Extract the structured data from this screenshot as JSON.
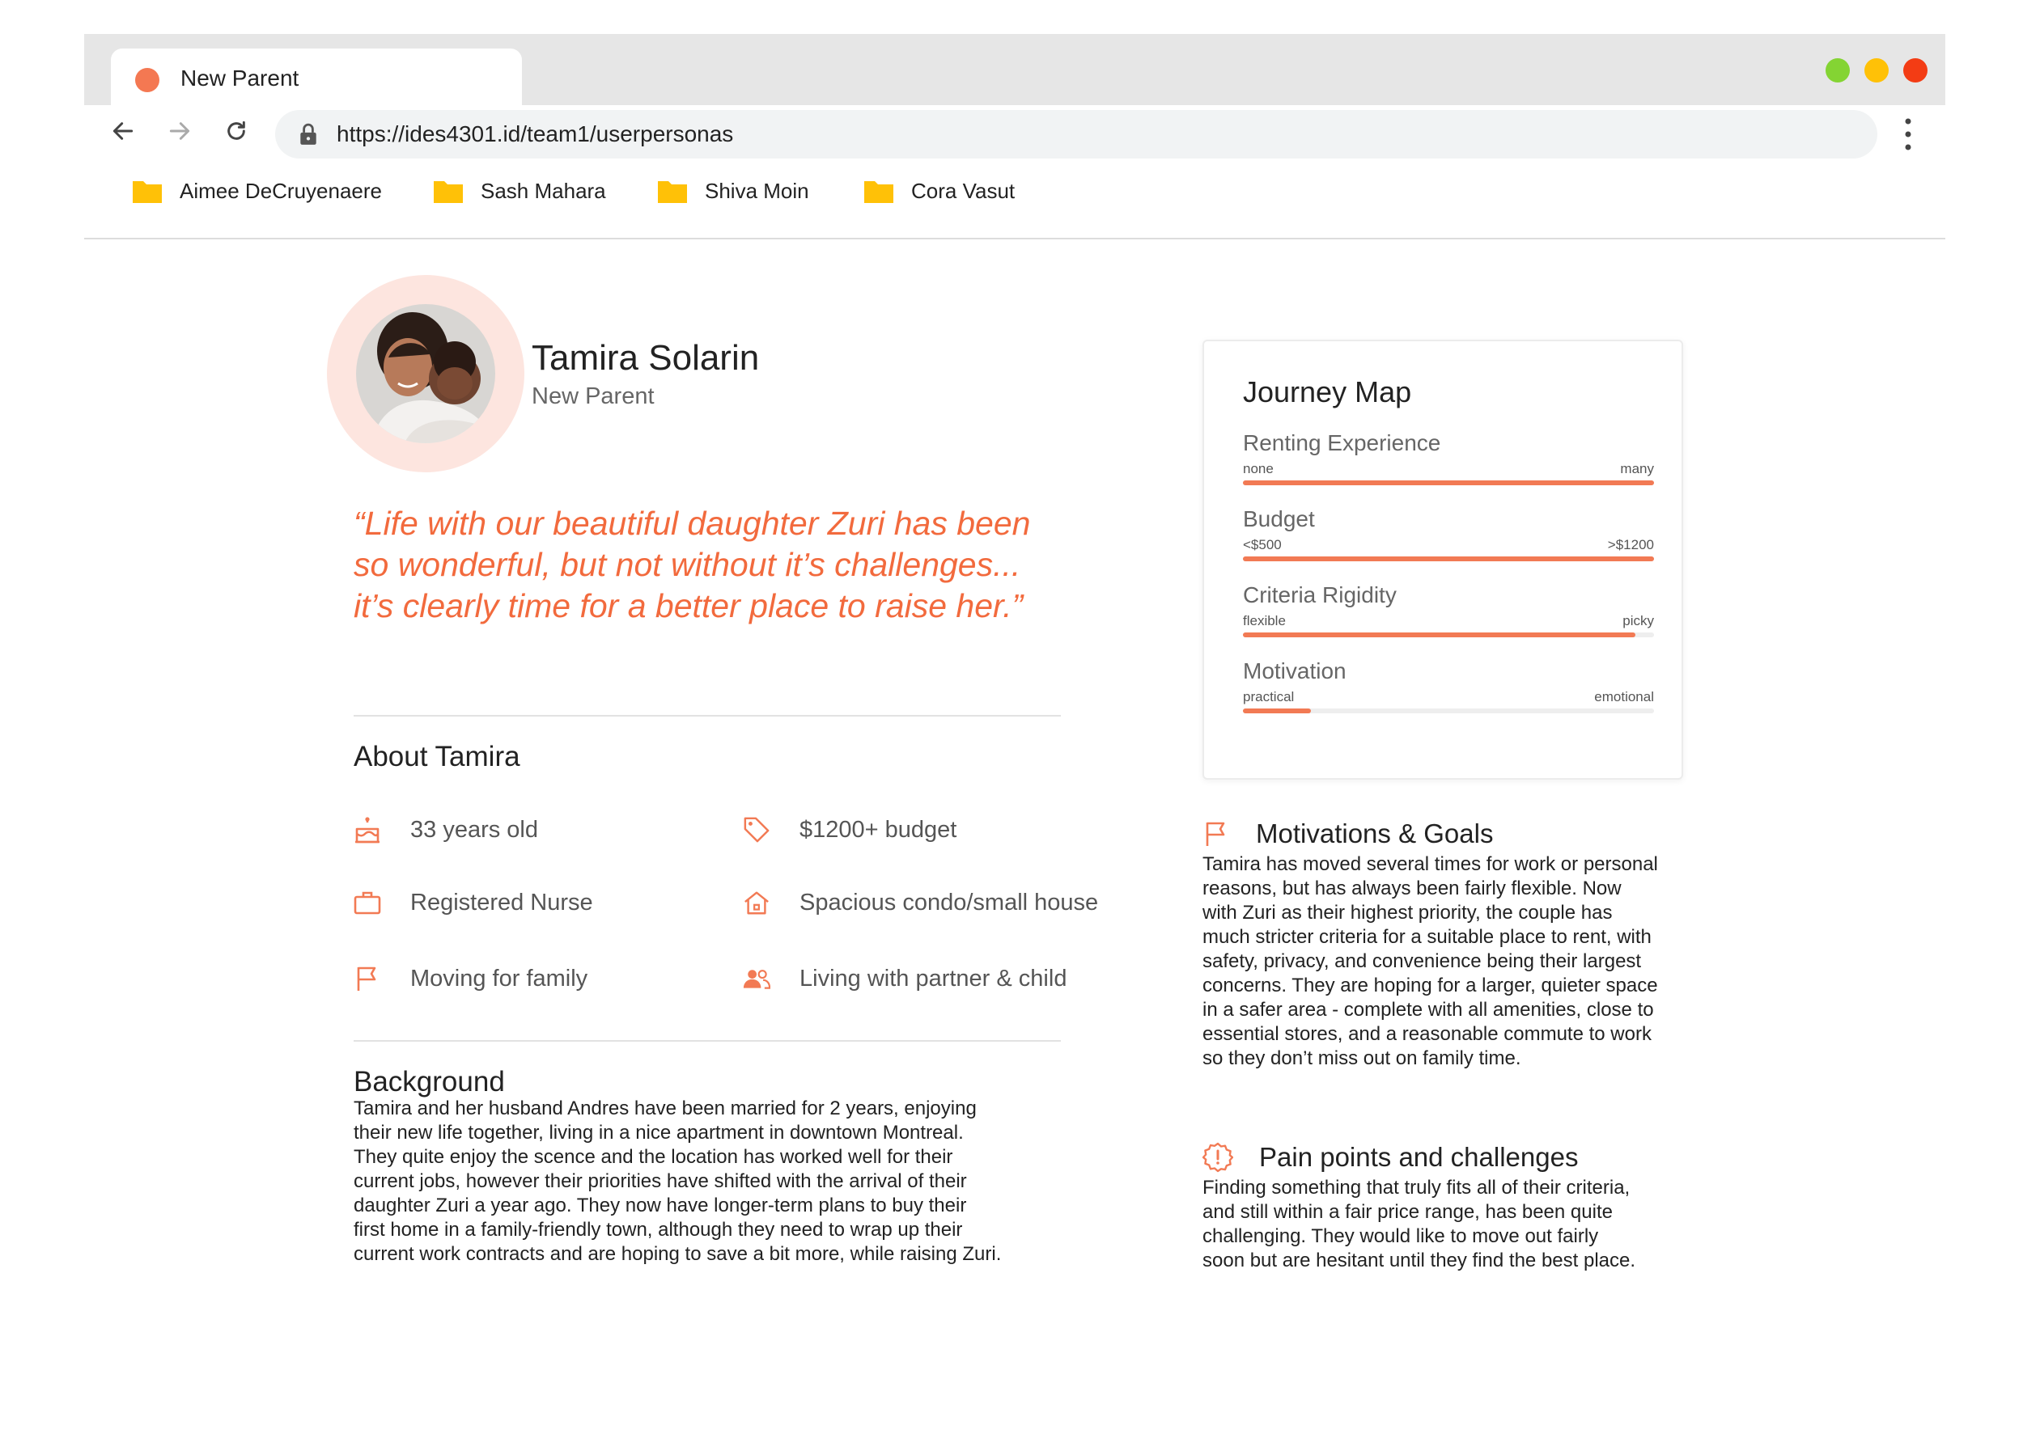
{
  "window": {
    "tab_title": "New Parent",
    "tab_dot_color": "#f47852",
    "controls": [
      {
        "name": "minimize",
        "color": "#84d433"
      },
      {
        "name": "maximize",
        "color": "#ffc107"
      },
      {
        "name": "close",
        "color": "#f33c14"
      }
    ]
  },
  "toolbar": {
    "back_icon": "arrow-left-icon",
    "forward_icon": "arrow-right-icon",
    "reload_icon": "reload-icon",
    "url": "https://ides4301.id/team1/userpersonas",
    "menu_icon": "kebab-menu-icon"
  },
  "bookmarks": [
    {
      "label": "Aimee DeCruyenaere",
      "icon": "folder-icon"
    },
    {
      "label": "Sash Mahara",
      "icon": "folder-icon"
    },
    {
      "label": "Shiva Moin",
      "icon": "folder-icon"
    },
    {
      "label": "Cora Vasut",
      "icon": "folder-icon"
    }
  ],
  "persona": {
    "name": "Tamira Solarin",
    "role": "New Parent",
    "quote_lines": [
      "“Life with our beautiful daughter Zuri has been",
      "so wonderful, but not without it’s challenges...",
      "it’s clearly time for a better place to raise her.”"
    ]
  },
  "about": {
    "title": "About Tamira",
    "facts": [
      {
        "label": "33 years old",
        "icon": "birthday-cake-icon"
      },
      {
        "label": "$1200+ budget",
        "icon": "price-tag-icon"
      },
      {
        "label": "Registered Nurse",
        "icon": "briefcase-icon"
      },
      {
        "label": "Spacious condo/small house",
        "icon": "house-icon"
      },
      {
        "label": "Moving for family",
        "icon": "flag-icon"
      },
      {
        "label": "Living with partner & child",
        "icon": "people-icon"
      }
    ]
  },
  "background": {
    "title": "Background",
    "lines": [
      "Tamira and her husband Andres have been married for 2 years, enjoying",
      "their new life together, living in a nice apartment in downtown Montreal.",
      "They quite enjoy the scence and the location has worked well for their",
      "current jobs, however their priorities have shifted with the arrival of their",
      "daughter Zuri a year ago. They now have longer-term plans to buy their",
      "first home in a family-friendly town, although they need to wrap up their",
      "current work contracts and are hoping to save a bit more, while raising Zuri."
    ]
  },
  "journey": {
    "title": "Journey Map",
    "rows": [
      {
        "label": "Renting Experience",
        "min": "none",
        "max": "many",
        "level": 1.0
      },
      {
        "label": "Budget",
        "min": "<$500",
        "max": ">$1200",
        "level": 1.0
      },
      {
        "label": "Criteria Rigidity",
        "min": "flexible",
        "max": "picky",
        "level": 0.955
      },
      {
        "label": "Motivation",
        "min": "practical",
        "max": "emotional",
        "level": 0.165
      }
    ],
    "accent_color": "#f27a54"
  },
  "motivations": {
    "title": "Motivations & Goals",
    "icon": "flag-icon",
    "lines": [
      "Tamira has moved several times for work or personal",
      "reasons, but has always been fairly flexible. Now",
      "with Zuri as their highest priority, the couple has",
      "much stricter criteria for a suitable place to rent, with",
      "safety, privacy, and convenience being their largest",
      "concerns. They are hoping for a larger, quieter space",
      "in a safer area - complete with all amenities, close to",
      "essential stores, and a reasonable commute to work",
      "so they don’t miss out on family time."
    ]
  },
  "pain_points": {
    "title": "Pain points and challenges",
    "icon": "alert-badge-icon",
    "lines": [
      "Finding something that truly fits all of their criteria,",
      "and still within a fair price range, has been quite",
      "challenging. They would like to move out fairly",
      "soon but are hesitant until they find the best place."
    ]
  },
  "colors": {
    "accent": "#f26a3d",
    "folder": "#ffc107"
  }
}
